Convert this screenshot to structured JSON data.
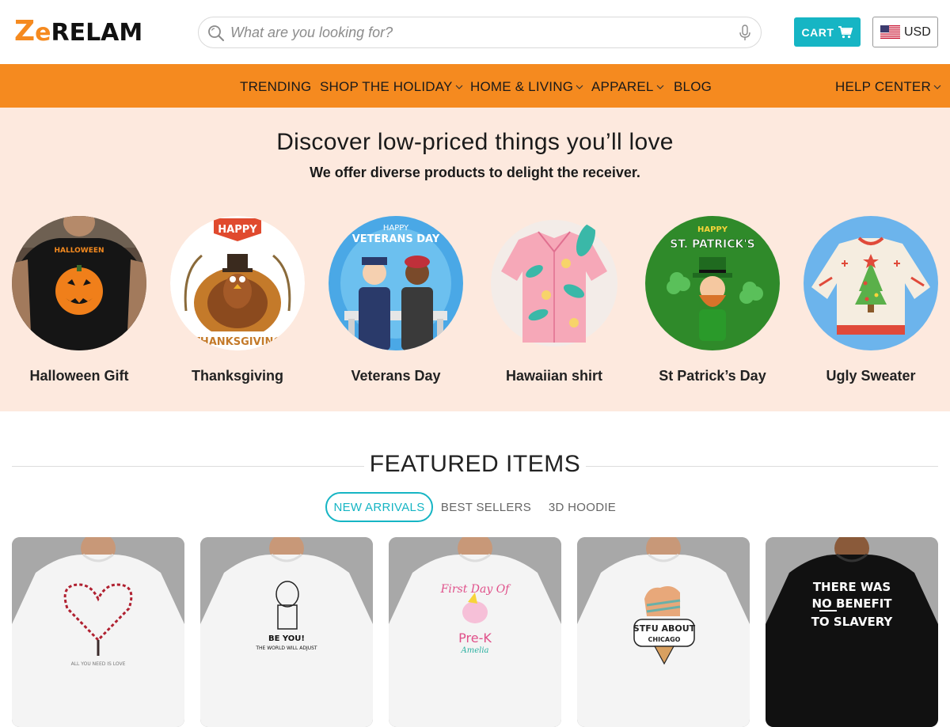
{
  "brand": {
    "logo_text": "ZERELAM",
    "logo_letter_z": "Z",
    "logo_letter_e": "e",
    "logo_rest": "RELAM"
  },
  "search": {
    "placeholder": "What are you looking for?"
  },
  "header": {
    "cart_label": "CART",
    "currency_label": "USD",
    "accent_color": "#16b5c4"
  },
  "nav": {
    "background_color": "#f58a1f",
    "items": [
      {
        "label": "TRENDING",
        "has_dropdown": false
      },
      {
        "label": "SHOP THE HOLIDAY",
        "has_dropdown": true
      },
      {
        "label": "HOME & LIVING",
        "has_dropdown": true
      },
      {
        "label": "APPAREL",
        "has_dropdown": true
      },
      {
        "label": "BLOG",
        "has_dropdown": false
      }
    ],
    "help": {
      "label": "HELP CENTER",
      "has_dropdown": true
    }
  },
  "hero": {
    "title": "Discover low-priced things you’ll love",
    "subtitle": "We offer diverse products to delight the receiver.",
    "categories": [
      {
        "label": "Halloween Gift",
        "image_text": "HALLOWEEN"
      },
      {
        "label": "Thanksgiving",
        "image_text": "HAPPY",
        "image_text2": "THANKSGIVING"
      },
      {
        "label": "Veterans Day",
        "image_text": "HAPPY",
        "image_text2": "VETERANS DAY"
      },
      {
        "label": "Hawaiian shirt"
      },
      {
        "label": "St Patrick’s Day",
        "image_text": "HAPPY",
        "image_text2": "ST. PATRICK'S"
      },
      {
        "label": "Ugly Sweater"
      }
    ]
  },
  "featured": {
    "title": "FEATURED ITEMS",
    "tabs": [
      {
        "label": "NEW ARRIVALS",
        "active": true
      },
      {
        "label": "BEST SELLERS",
        "active": false
      },
      {
        "label": "3D HOODIE",
        "active": false
      }
    ],
    "products": [
      {
        "shirt_color": "white",
        "print_text": "ALL YOU NEED IS LOVE"
      },
      {
        "shirt_color": "white",
        "print_text": "BE YOU!",
        "print_text2": "THE WORLD WILL ADJUST"
      },
      {
        "shirt_color": "white",
        "print_text": "First Day Of",
        "print_text2": "Pre-K",
        "print_text3": "Amelia"
      },
      {
        "shirt_color": "white",
        "print_text": "STFU ABOUT",
        "print_text2": "CHICAGO"
      },
      {
        "shirt_color": "black",
        "print_text": "THERE WAS",
        "print_text2": "NO BENEFIT",
        "print_text3": "TO SLAVERY"
      }
    ]
  }
}
